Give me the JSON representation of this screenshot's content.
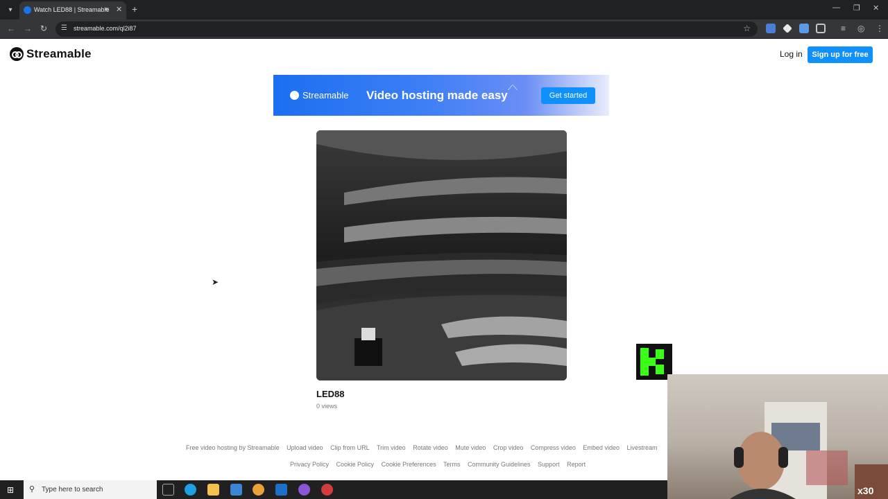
{
  "browser": {
    "tab_title": "Watch LED88 | Streamable",
    "url": "streamable.com/ql2i87"
  },
  "header": {
    "brand": "Streamable",
    "login_label": "Log in",
    "signup_label": "Sign up for free"
  },
  "banner": {
    "brand": "Streamable",
    "tagline": "Video hosting made easy",
    "cta_label": "Get started"
  },
  "video": {
    "title": "LED88",
    "views": "0 views"
  },
  "footer": {
    "row1": [
      "Free video hosting by Streamable",
      "Upload video",
      "Clip from URL",
      "Trim video",
      "Rotate video",
      "Mute video",
      "Crop video",
      "Compress video",
      "Embed video",
      "Livestream"
    ],
    "row2": [
      "Privacy Policy",
      "Cookie Policy",
      "Cookie Preferences",
      "Terms",
      "Community Guidelines",
      "Support",
      "Report"
    ]
  },
  "overlay": {
    "logo_letter": "K",
    "counter": "x30"
  },
  "taskbar": {
    "search_placeholder": "Type here to search"
  },
  "colors": {
    "accent": "#0f90fa",
    "chrome_dark": "#202124",
    "overlay_green": "#39ff14"
  }
}
